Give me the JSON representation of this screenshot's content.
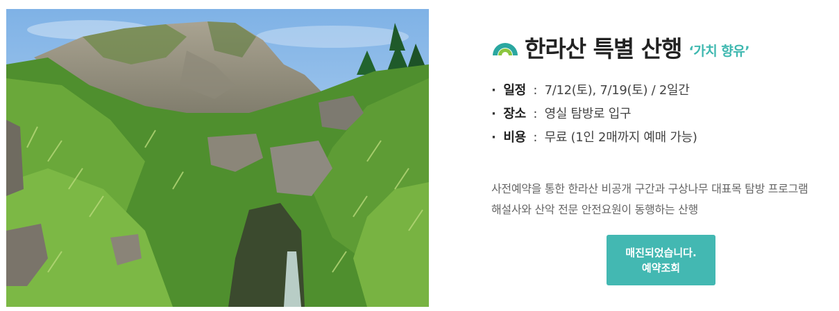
{
  "program": {
    "title": "한라산 특별 산행",
    "subtitle": "‘가치 향유’",
    "logo_icon": "mountain-arch-icon",
    "details": [
      {
        "bullet": "·",
        "key": "일정",
        "separator": ":",
        "value": "7/12(토), 7/19(토) / 2일간"
      },
      {
        "bullet": "·",
        "key": "장소",
        "separator": ":",
        "value": "영실 탐방로 입구"
      },
      {
        "bullet": "·",
        "key": "비용",
        "separator": ":",
        "value": "무료 (1인 2매까지 예매 가능)"
      }
    ],
    "description": [
      "사전예약을 통한 한라산 비공개 구간과 구상나무 대표목 탐방 프로그램",
      "해설사와 산악 전문 안전요원이 동행하는 산행"
    ],
    "button": {
      "line1": "매진되었습니다.",
      "line2": "예약조회"
    }
  },
  "colors": {
    "accent": "#43b8b2",
    "subtitle": "#3fb8b0",
    "logo_teal": "#2aa7a0",
    "logo_green": "#8cc63f"
  }
}
